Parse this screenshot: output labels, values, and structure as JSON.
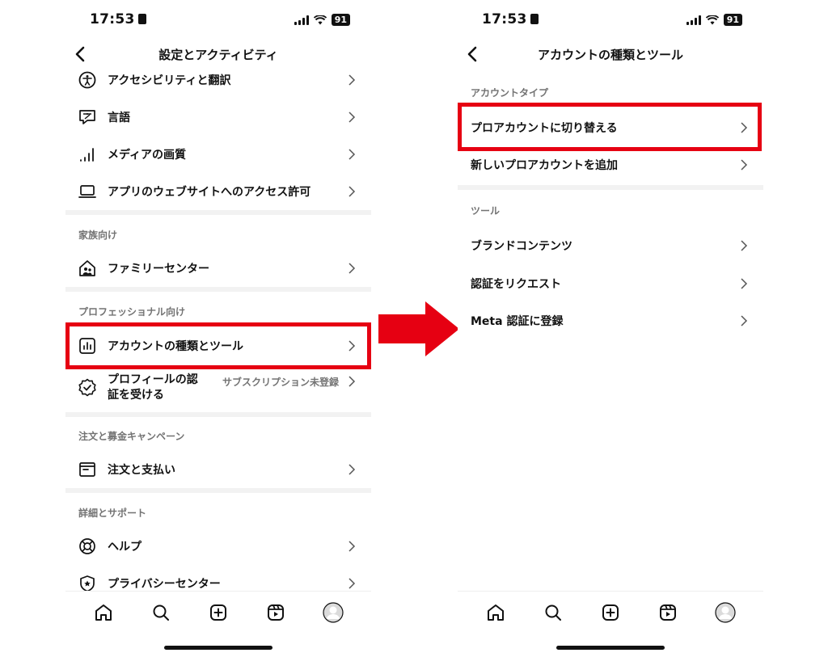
{
  "status_bar": {
    "time": "17:53",
    "battery": "91"
  },
  "left_screen": {
    "title": "設定とアクティビティ",
    "items_top": [
      {
        "label": "アクセシビリティと翻訳",
        "icon": "accessibility-icon"
      },
      {
        "label": "言語",
        "icon": "language-icon"
      },
      {
        "label": "メディアの画質",
        "icon": "signal-bars-icon"
      },
      {
        "label": "アプリのウェブサイトへのアクセス許可",
        "icon": "laptop-icon"
      }
    ],
    "section_family": "家族向け",
    "family_center": "ファミリーセンター",
    "section_professional": "プロフェッショナル向け",
    "account_types_tools": "アカウントの種類とツール",
    "verified_line1": "プロフィールの認",
    "verified_line2": "証を受ける",
    "verified_status": "サブスクリプション未登録",
    "section_orders": "注文と募金キャンペーン",
    "orders_payments": "注文と支払い",
    "section_more": "詳細とサポート",
    "help": "ヘルプ",
    "privacy_center": "プライバシーセンター"
  },
  "right_screen": {
    "title": "アカウントの種類とツール",
    "section_account_type": "アカウントタイプ",
    "switch_pro": "プロアカウントに切り替える",
    "add_pro": "新しいプロアカウントを追加",
    "section_tools": "ツール",
    "branded_content": "ブランドコンテンツ",
    "request_verification": "認証をリクエスト",
    "meta_verified": "Meta 認証に登録"
  },
  "colors": {
    "highlight": "#e60012",
    "text": "#111111",
    "muted": "#737373"
  },
  "tab_icons": [
    "home-icon",
    "search-icon",
    "create-icon",
    "reels-icon",
    "profile-icon"
  ]
}
